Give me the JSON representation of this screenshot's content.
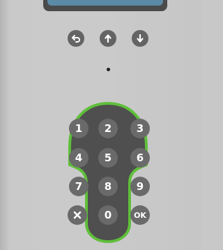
{
  "display": {
    "screen_color": "#5a8aa6"
  },
  "nav": {
    "back_icon": "back-arrow-icon",
    "up_icon": "up-arrow-icon",
    "down_icon": "down-arrow-icon"
  },
  "keypad": {
    "accent_color": "#5fbf3a",
    "keys": {
      "k1": "1",
      "k2": "2",
      "k3": "3",
      "k4": "4",
      "k5": "5",
      "k6": "6",
      "k7": "7",
      "k8": "8",
      "k9": "9",
      "k0": "0",
      "ok": "OK",
      "cancel_icon": "close-icon"
    }
  }
}
